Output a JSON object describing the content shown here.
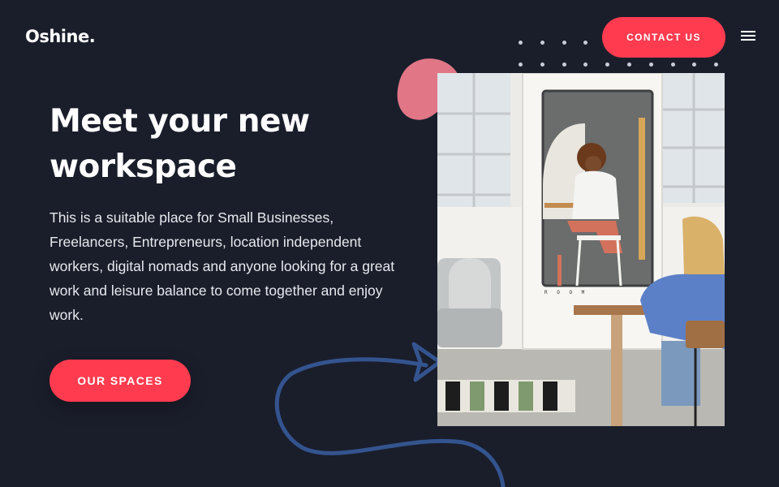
{
  "header": {
    "logo": "Oshine.",
    "contact_label": "CONTACT US",
    "menu_icon": "hamburger-menu-icon"
  },
  "hero": {
    "title": "Meet your new workspace",
    "description": "This is a suitable place for Small Businesses, Freelancers, Entrepreneurs, location independent workers, digital nomads and anyone looking for a great work and leisure balance to come together and enjoy work.",
    "cta_label": "OUR SPACES"
  },
  "decor": {
    "blob_icon": "pink-blob-shape",
    "squiggle_icon": "blue-squiggle-arrow",
    "dots_icon": "dot-grid-pattern"
  },
  "photo": {
    "subject": "workspace-photo",
    "booth_lettering": "R O O M"
  },
  "colors": {
    "background": "#1a1e2b",
    "accent": "#ff3b4f",
    "blob": "#e07686",
    "squiggle": "#34548f"
  }
}
